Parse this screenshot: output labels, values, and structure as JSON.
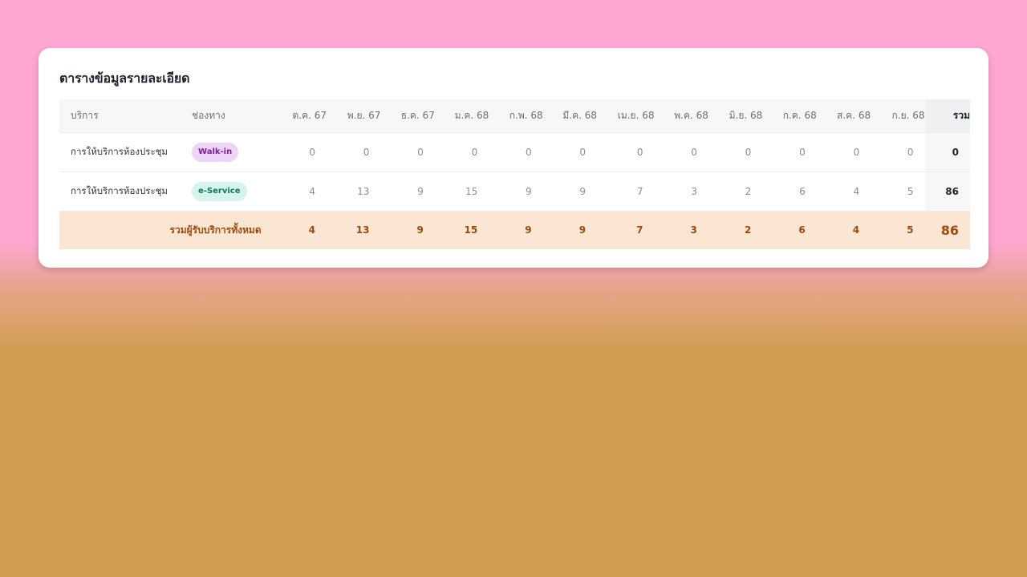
{
  "card": {
    "title": "ตารางข้อมูลรายละเอียด"
  },
  "table": {
    "headers": {
      "service": "บริการ",
      "channel": "ช่องทาง",
      "months": [
        "ต.ค. 67",
        "พ.ย. 67",
        "ธ.ค. 67",
        "ม.ค. 68",
        "ก.พ. 68",
        "มี.ค. 68",
        "เม.ย. 68",
        "พ.ค. 68",
        "มิ.ย. 68",
        "ก.ค. 68",
        "ส.ค. 68",
        "ก.ย. 68"
      ],
      "total": "รวม"
    },
    "rows": [
      {
        "service": "การให้บริการห้องประชุม",
        "channel": "Walk-in",
        "values": [
          "0",
          "0",
          "0",
          "0",
          "0",
          "0",
          "0",
          "0",
          "0",
          "0",
          "0",
          "0"
        ],
        "total": "0"
      },
      {
        "service": "การให้บริการห้องประชุม",
        "channel": "e-Service",
        "values": [
          "4",
          "13",
          "9",
          "15",
          "9",
          "9",
          "7",
          "3",
          "2",
          "6",
          "4",
          "5"
        ],
        "total": "86"
      }
    ],
    "footer": {
      "label": "รวมผู้รับบริการทั้งหมด",
      "values": [
        "4",
        "13",
        "9",
        "15",
        "9",
        "9",
        "7",
        "3",
        "2",
        "6",
        "4",
        "5"
      ],
      "total": "86"
    }
  },
  "colors": {
    "walkin_badge_bg": "#ecd5f7",
    "walkin_badge_text": "#7a1f93",
    "eservice_badge_bg": "#d6f3ec",
    "eservice_badge_text": "#12765c",
    "footer_bg": "#fbe6d3",
    "footer_text": "#a04a0c"
  }
}
